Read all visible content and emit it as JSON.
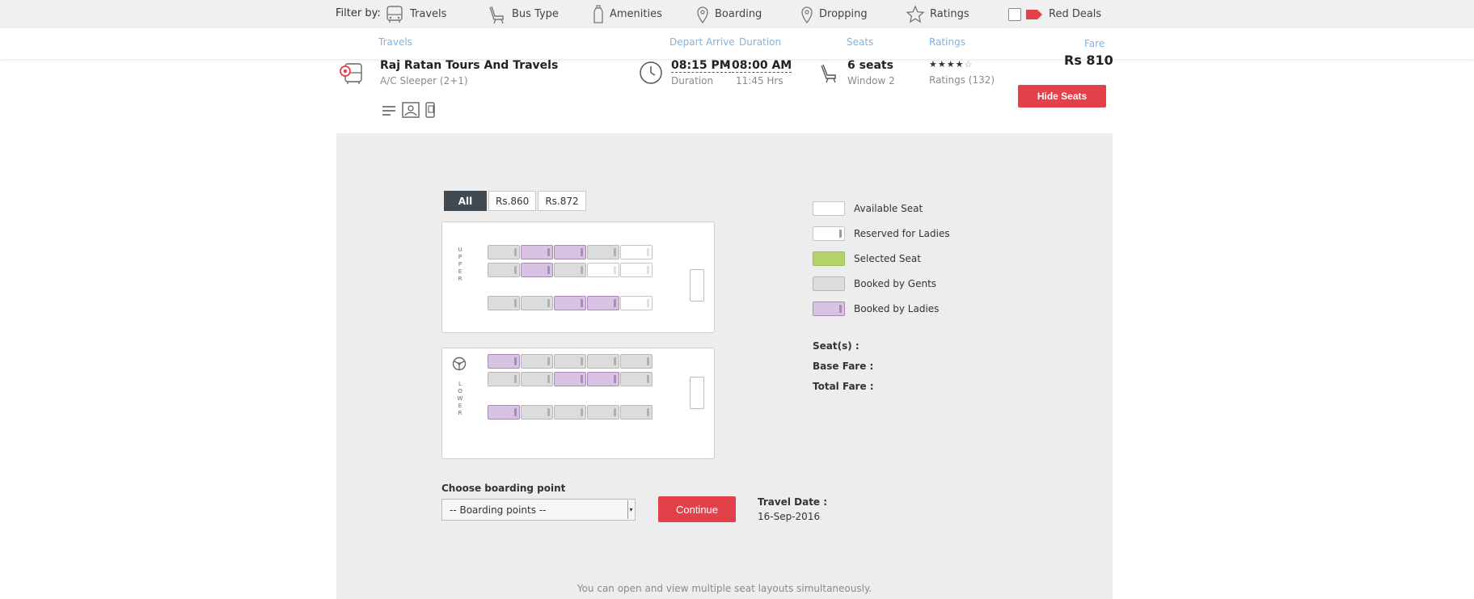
{
  "filters": {
    "label": "Filter by:",
    "items": [
      {
        "label": "Travels",
        "icon": "bus-icon"
      },
      {
        "label": "Bus Type",
        "icon": "seat-icon"
      },
      {
        "label": "Amenities",
        "icon": "bottle-icon"
      },
      {
        "label": "Boarding",
        "icon": "location-pin-icon"
      },
      {
        "label": "Dropping",
        "icon": "location-pin-icon"
      },
      {
        "label": "Ratings",
        "icon": "star-icon"
      }
    ],
    "red_deals": {
      "label": "Red Deals",
      "checked": false
    }
  },
  "columns": {
    "travels": "Travels",
    "depart": "Depart",
    "arrive": "Arrive",
    "duration": "Duration",
    "seats": "Seats",
    "ratings": "Ratings",
    "fare": "Fare"
  },
  "bus": {
    "name": "Raj Ratan Tours And Travels",
    "type": "A/C Sleeper (2+1)",
    "depart": "08:15 PM",
    "separator": "-",
    "arrive": "08:00 AM",
    "duration_label": "Duration",
    "duration_value": "11:45 Hrs",
    "seats": "6 seats",
    "window": "Window 2",
    "rating_stars": 4,
    "ratings_text": "Ratings (132)",
    "fare": "Rs 810",
    "hide_button": "Hide Seats"
  },
  "seat_layout": {
    "price_tabs": [
      {
        "label": "All",
        "active": true
      },
      {
        "label": "Rs.860",
        "active": false
      },
      {
        "label": "Rs.872",
        "active": false
      }
    ],
    "upper_label": "UPPER",
    "lower_label": "LOWER",
    "upper_rows": [
      [
        "gents",
        "ladies",
        "ladies",
        "gents",
        "available"
      ],
      [
        "gents",
        "ladies",
        "gents",
        "available",
        "available"
      ],
      [
        "gents",
        "gents",
        "ladies",
        "ladies",
        "available"
      ]
    ],
    "lower_rows": [
      [
        "ladies",
        "gents",
        "gents",
        "gents",
        "gents"
      ],
      [
        "gents",
        "gents",
        "ladies",
        "ladies",
        "gents"
      ],
      [
        "ladies",
        "gents",
        "gents",
        "gents",
        "gents"
      ]
    ],
    "legend": [
      {
        "label": "Available Seat",
        "kind": "available"
      },
      {
        "label": "Reserved for Ladies",
        "kind": "reserved-ladies"
      },
      {
        "label": "Selected Seat",
        "kind": "selected"
      },
      {
        "label": "Booked by Gents",
        "kind": "gents"
      },
      {
        "label": "Booked by Ladies",
        "kind": "ladies"
      }
    ],
    "colors": {
      "selected": "#b3d36a",
      "ladies": "#d9c3e3",
      "gents": "#dcdcdc",
      "accent": "#e3404a"
    },
    "seats_label": "Seat(s) :",
    "base_fare_label": "Base Fare :",
    "total_fare_label": "Total Fare :",
    "boarding_label": "Choose boarding point",
    "boarding_placeholder": "-- Boarding points --",
    "continue_button": "Continue",
    "travel_date_label": "Travel Date :",
    "travel_date_value": "16-Sep-2016",
    "note": "You can open and view multiple seat layouts simultaneously."
  }
}
